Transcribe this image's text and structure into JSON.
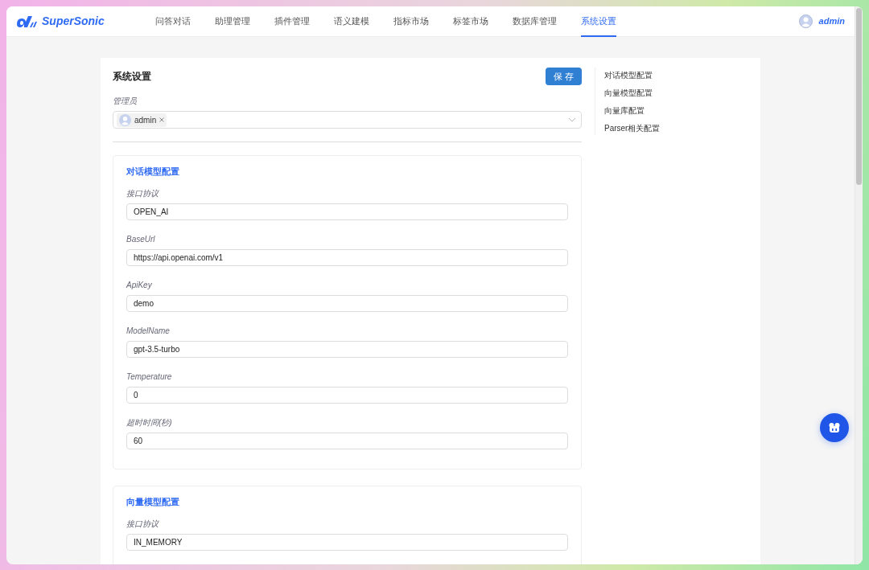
{
  "header": {
    "logo": "SuperSonic",
    "nav": [
      {
        "label": "问答对话",
        "selected": false
      },
      {
        "label": "助理管理",
        "selected": false
      },
      {
        "label": "插件管理",
        "selected": false
      },
      {
        "label": "语义建模",
        "selected": false
      },
      {
        "label": "指标市场",
        "selected": false
      },
      {
        "label": "标签市场",
        "selected": false
      },
      {
        "label": "数据库管理",
        "selected": false
      },
      {
        "label": "系统设置",
        "selected": true
      }
    ],
    "user": "admin"
  },
  "settings": {
    "title": "系统设置",
    "save_button": "保 存",
    "admin_label": "管理员",
    "admins": [
      "admin"
    ],
    "sections": [
      {
        "title": "对话模型配置",
        "fields": [
          {
            "label": "接口协议",
            "value": "OPEN_AI"
          },
          {
            "label": "BaseUrl",
            "value": "https://api.openai.com/v1"
          },
          {
            "label": "ApiKey",
            "value": "demo"
          },
          {
            "label": "ModelName",
            "value": "gpt-3.5-turbo"
          },
          {
            "label": "Temperature",
            "value": "0"
          },
          {
            "label": "超时时间(秒)",
            "value": "60"
          }
        ]
      },
      {
        "title": "向量模型配置",
        "fields": [
          {
            "label": "接口协议",
            "value": "IN_MEMORY"
          }
        ]
      }
    ]
  },
  "anchors": [
    "对话模型配置",
    "向量模型配置",
    "向量库配置",
    "Parser相关配置"
  ]
}
